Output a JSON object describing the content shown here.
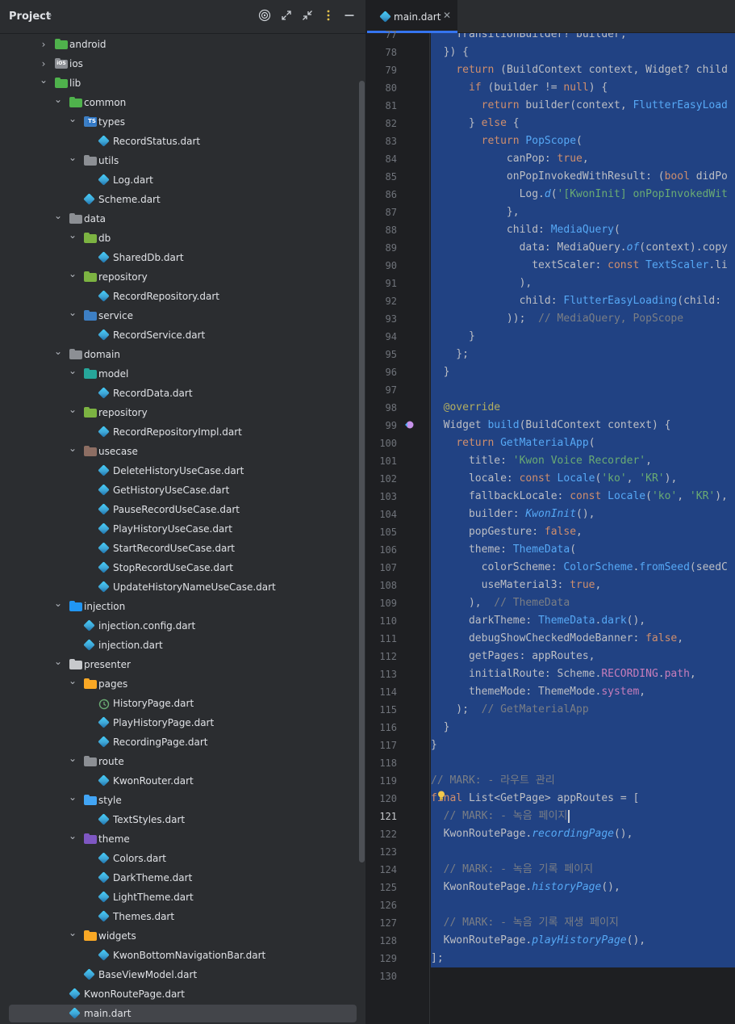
{
  "project_panel": {
    "title": "Project",
    "header_icons": [
      "target-icon",
      "expand-icon",
      "collapse-icon",
      "more-icon",
      "minimize-icon"
    ],
    "tree": [
      {
        "label": "android",
        "depth": 1,
        "kind": "folder",
        "expanded": false,
        "color": "#4fb24c"
      },
      {
        "label": "ios",
        "depth": 1,
        "kind": "folder-ios",
        "expanded": false,
        "color": "#8c8f94"
      },
      {
        "label": "lib",
        "depth": 1,
        "kind": "folder",
        "expanded": true,
        "color": "#4fb24c"
      },
      {
        "label": "common",
        "depth": 2,
        "kind": "folder",
        "expanded": true,
        "color": "#4fb24c"
      },
      {
        "label": "types",
        "depth": 3,
        "kind": "folder-ts",
        "expanded": true,
        "color": "#3d7fc4"
      },
      {
        "label": "RecordStatus.dart",
        "depth": 4,
        "kind": "dart"
      },
      {
        "label": "utils",
        "depth": 3,
        "kind": "folder-utils",
        "expanded": true,
        "color": "#8c8f94"
      },
      {
        "label": "Log.dart",
        "depth": 4,
        "kind": "dart"
      },
      {
        "label": "Scheme.dart",
        "depth": 3,
        "kind": "dart"
      },
      {
        "label": "data",
        "depth": 2,
        "kind": "folder",
        "expanded": true,
        "color": "#8c8f94"
      },
      {
        "label": "db",
        "depth": 3,
        "kind": "folder",
        "expanded": true,
        "color": "#7cb342"
      },
      {
        "label": "SharedDb.dart",
        "depth": 4,
        "kind": "dart"
      },
      {
        "label": "repository",
        "depth": 3,
        "kind": "folder",
        "expanded": true,
        "color": "#7cb342"
      },
      {
        "label": "RecordRepository.dart",
        "depth": 4,
        "kind": "dart"
      },
      {
        "label": "service",
        "depth": 3,
        "kind": "folder-service",
        "expanded": true,
        "color": "#3d7fc4"
      },
      {
        "label": "RecordService.dart",
        "depth": 4,
        "kind": "dart"
      },
      {
        "label": "domain",
        "depth": 2,
        "kind": "folder",
        "expanded": true,
        "color": "#8c8f94"
      },
      {
        "label": "model",
        "depth": 3,
        "kind": "folder",
        "expanded": true,
        "color": "#26a69a"
      },
      {
        "label": "RecordData.dart",
        "depth": 4,
        "kind": "dart"
      },
      {
        "label": "repository",
        "depth": 3,
        "kind": "folder",
        "expanded": true,
        "color": "#7cb342"
      },
      {
        "label": "RecordRepositoryImpl.dart",
        "depth": 4,
        "kind": "dart"
      },
      {
        "label": "usecase",
        "depth": 3,
        "kind": "folder",
        "expanded": true,
        "color": "#8d6e63"
      },
      {
        "label": "DeleteHistoryUseCase.dart",
        "depth": 4,
        "kind": "dart"
      },
      {
        "label": "GetHistoryUseCase.dart",
        "depth": 4,
        "kind": "dart"
      },
      {
        "label": "PauseRecordUseCase.dart",
        "depth": 4,
        "kind": "dart"
      },
      {
        "label": "PlayHistoryUseCase.dart",
        "depth": 4,
        "kind": "dart"
      },
      {
        "label": "StartRecordUseCase.dart",
        "depth": 4,
        "kind": "dart"
      },
      {
        "label": "StopRecordUseCase.dart",
        "depth": 4,
        "kind": "dart"
      },
      {
        "label": "UpdateHistoryNameUseCase.dart",
        "depth": 4,
        "kind": "dart"
      },
      {
        "label": "injection",
        "depth": 2,
        "kind": "folder",
        "expanded": true,
        "color": "#2196f3"
      },
      {
        "label": "injection.config.dart",
        "depth": 3,
        "kind": "dart"
      },
      {
        "label": "injection.dart",
        "depth": 3,
        "kind": "dart"
      },
      {
        "label": "presenter",
        "depth": 2,
        "kind": "folder",
        "expanded": true,
        "color": "#c7c9cc"
      },
      {
        "label": "pages",
        "depth": 3,
        "kind": "folder",
        "expanded": true,
        "color": "#f9a825"
      },
      {
        "label": "HistoryPage.dart",
        "depth": 4,
        "kind": "history"
      },
      {
        "label": "PlayHistoryPage.dart",
        "depth": 4,
        "kind": "dart"
      },
      {
        "label": "RecordingPage.dart",
        "depth": 4,
        "kind": "dart"
      },
      {
        "label": "route",
        "depth": 3,
        "kind": "folder-route",
        "expanded": true,
        "color": "#8c8f94"
      },
      {
        "label": "KwonRouter.dart",
        "depth": 4,
        "kind": "dart"
      },
      {
        "label": "style",
        "depth": 3,
        "kind": "folder",
        "expanded": true,
        "color": "#42a5f5"
      },
      {
        "label": "TextStyles.dart",
        "depth": 4,
        "kind": "dart"
      },
      {
        "label": "theme",
        "depth": 3,
        "kind": "folder-theme",
        "expanded": true,
        "color": "#7e57c2"
      },
      {
        "label": "Colors.dart",
        "depth": 4,
        "kind": "dart"
      },
      {
        "label": "DarkTheme.dart",
        "depth": 4,
        "kind": "dart"
      },
      {
        "label": "LightTheme.dart",
        "depth": 4,
        "kind": "dart"
      },
      {
        "label": "Themes.dart",
        "depth": 4,
        "kind": "dart"
      },
      {
        "label": "widgets",
        "depth": 3,
        "kind": "folder",
        "expanded": true,
        "color": "#f9a825"
      },
      {
        "label": "KwonBottomNavigationBar.dart",
        "depth": 4,
        "kind": "dart"
      },
      {
        "label": "BaseViewModel.dart",
        "depth": 3,
        "kind": "dart"
      },
      {
        "label": "KwonRoutePage.dart",
        "depth": 2,
        "kind": "dart"
      },
      {
        "label": "main.dart",
        "depth": 2,
        "kind": "dart",
        "selected": true
      }
    ]
  },
  "editor": {
    "tab": {
      "label": "main.dart",
      "close": "✕"
    },
    "current_line": 121,
    "lines": [
      {
        "n": "77",
        "html": "    <span class='cls'>TransitionBuilder</span>? builder,"
      },
      {
        "n": "78",
        "html": "  }) {"
      },
      {
        "n": "79",
        "html": "    <span class='kw'>return</span> (<span class='cls'>BuildContext</span> context, <span class='cls'>Widget</span>? child"
      },
      {
        "n": "80",
        "html": "      <span class='kw'>if</span> (builder != <span class='kw'>null</span>) {"
      },
      {
        "n": "81",
        "html": "        <span class='kw'>return</span> builder(context, <span class='fn'>FlutterEasyLoad</span>"
      },
      {
        "n": "82",
        "html": "      } <span class='kw'>else</span> {"
      },
      {
        "n": "83",
        "html": "        <span class='kw'>return</span> <span class='fn'>PopScope</span>("
      },
      {
        "n": "84",
        "html": "            canPop: <span class='kw'>true</span>,"
      },
      {
        "n": "85",
        "html": "            onPopInvokedWithResult: (<span class='kw'>bool</span> didPo"
      },
      {
        "n": "86",
        "html": "              Log.<span class='it'>d</span>(<span class='str'>'[KwonInit] onPopInvokedWit</span>"
      },
      {
        "n": "87",
        "html": "            },"
      },
      {
        "n": "88",
        "html": "            child: <span class='fn'>MediaQuery</span>("
      },
      {
        "n": "89",
        "html": "              data: MediaQuery.<span class='it'>of</span>(context).copy"
      },
      {
        "n": "90",
        "html": "                textScaler: <span class='kw'>const</span> <span class='fn'>TextScaler</span>.li"
      },
      {
        "n": "91",
        "html": "              ),"
      },
      {
        "n": "92",
        "html": "              child: <span class='fn'>FlutterEasyLoading</span>(child:"
      },
      {
        "n": "93",
        "html": "            ));  <span class='cm'>// MediaQuery, PopScope</span>"
      },
      {
        "n": "94",
        "html": "      }"
      },
      {
        "n": "95",
        "html": "    };"
      },
      {
        "n": "96",
        "html": "  }"
      },
      {
        "n": "97",
        "html": ""
      },
      {
        "n": "98",
        "html": "  <span class='ann'>@override</span>"
      },
      {
        "n": "99",
        "html": "  <span class='cls'>Widget</span> <span class='fn'>build</span>(<span class='cls'>BuildContext</span> context) {"
      },
      {
        "n": "100",
        "html": "    <span class='kw'>return</span> <span class='fn'>GetMaterialApp</span>("
      },
      {
        "n": "101",
        "html": "      title: <span class='str'>'Kwon Voice Recorder'</span>,"
      },
      {
        "n": "102",
        "html": "      locale: <span class='kw'>const</span> <span class='fn'>Locale</span>(<span class='str'>'ko'</span>, <span class='str'>'KR'</span>),"
      },
      {
        "n": "103",
        "html": "      fallbackLocale: <span class='kw'>const</span> <span class='fn'>Locale</span>(<span class='str'>'ko'</span>, <span class='str'>'KR'</span>),"
      },
      {
        "n": "104",
        "html": "      builder: <span class='it'>KwonInit</span>(),"
      },
      {
        "n": "105",
        "html": "      popGesture: <span class='kw'>false</span>,"
      },
      {
        "n": "106",
        "html": "      theme: <span class='fn'>ThemeData</span>("
      },
      {
        "n": "107",
        "html": "        colorScheme: <span class='fn'>ColorScheme</span>.<span class='fn'>fromSeed</span>(seedC"
      },
      {
        "n": "108",
        "html": "        useMaterial3: <span class='kw'>true</span>,"
      },
      {
        "n": "109",
        "html": "      ),  <span class='cm'>// ThemeData</span>"
      },
      {
        "n": "110",
        "html": "      darkTheme: <span class='fn'>ThemeData</span>.<span class='fn'>dark</span>(),"
      },
      {
        "n": "111",
        "html": "      debugShowCheckedModeBanner: <span class='kw'>false</span>,"
      },
      {
        "n": "112",
        "html": "      getPages: appRoutes,"
      },
      {
        "n": "113",
        "html": "      initialRoute: Scheme.<span class='pr'>RECORDING</span>.<span class='pr'>path</span>,"
      },
      {
        "n": "114",
        "html": "      themeMode: ThemeMode.<span class='pr'>system</span>,"
      },
      {
        "n": "115",
        "html": "    );  <span class='cm'>// GetMaterialApp</span>"
      },
      {
        "n": "116",
        "html": "  }"
      },
      {
        "n": "117",
        "html": "}"
      },
      {
        "n": "118",
        "html": ""
      },
      {
        "n": "119",
        "html": "<span class='cm'>// MARK: - 라우트 관리</span>"
      },
      {
        "n": "120",
        "html": "<span class='kw'>final</span> <span class='cls'>List</span>&lt;<span class='cls'>GetPage</span>&gt; appRoutes = ["
      },
      {
        "n": "121",
        "html": "  <span class='cm'>// MARK: - 녹음 페이지</span>"
      },
      {
        "n": "122",
        "html": "  KwonRoutePage.<span class='it'>recordingPage</span>(),"
      },
      {
        "n": "123",
        "html": ""
      },
      {
        "n": "124",
        "html": "  <span class='cm'>// MARK: - 녹음 기록 페이지</span>"
      },
      {
        "n": "125",
        "html": "  KwonRoutePage.<span class='it'>historyPage</span>(),"
      },
      {
        "n": "126",
        "html": ""
      },
      {
        "n": "127",
        "html": "  <span class='cm'>// MARK: - 녹음 기록 재생 페이지</span>"
      },
      {
        "n": "128",
        "html": "  KwonRoutePage.<span class='it'>playHistoryPage</span>(),"
      },
      {
        "n": "129",
        "html": "];"
      },
      {
        "n": "130",
        "html": ""
      }
    ]
  },
  "colors": {
    "panel_bg": "#2b2d30",
    "editor_bg": "#1e1f22",
    "selection": "#214283",
    "accent": "#3574f0"
  }
}
